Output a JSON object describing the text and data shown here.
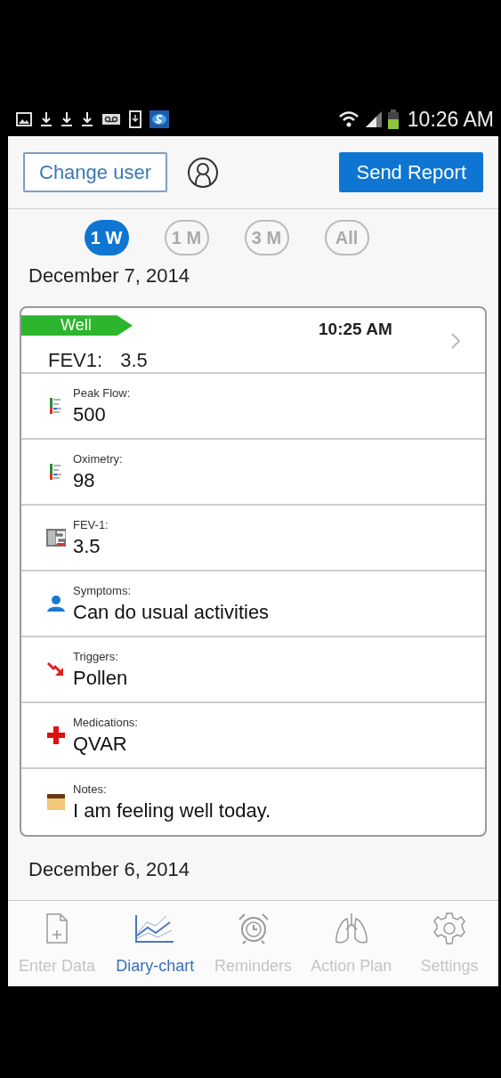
{
  "status_bar": {
    "time": "10:26 AM"
  },
  "header": {
    "change_user": "Change user",
    "send_report": "Send Report"
  },
  "ranges": [
    {
      "label": "1 W",
      "selected": true
    },
    {
      "label": "1 M",
      "selected": false
    },
    {
      "label": "3 M",
      "selected": false
    },
    {
      "label": "All",
      "selected": false
    }
  ],
  "days": [
    {
      "date": "December 7, 2014",
      "entry": {
        "status": "Well",
        "color": "#2db52d",
        "time": "10:25 AM",
        "summary_label": "FEV1:",
        "summary_value": "3.5",
        "fields": [
          {
            "kind": "peak_flow",
            "label": "Peak Flow:",
            "value": "500"
          },
          {
            "kind": "oximetry",
            "label": "Oximetry:",
            "value": "98"
          },
          {
            "kind": "fev1",
            "label": "FEV-1:",
            "value": "3.5"
          },
          {
            "kind": "symptoms",
            "label": "Symptoms:",
            "value": "Can do usual activities"
          },
          {
            "kind": "triggers",
            "label": "Triggers:",
            "value": "Pollen"
          },
          {
            "kind": "medications",
            "label": "Medications:",
            "value": "QVAR"
          },
          {
            "kind": "notes",
            "label": "Notes:",
            "value": "I am feeling well today."
          }
        ]
      }
    },
    {
      "date": "December 6, 2014"
    }
  ],
  "nav": [
    {
      "kind": "enter",
      "label": "Enter Data",
      "selected": false
    },
    {
      "kind": "chart",
      "label": "Diary-chart",
      "selected": true
    },
    {
      "kind": "alarm",
      "label": "Reminders",
      "selected": false
    },
    {
      "kind": "lungs",
      "label": "Action Plan",
      "selected": false
    },
    {
      "kind": "gear",
      "label": "Settings",
      "selected": false
    }
  ]
}
